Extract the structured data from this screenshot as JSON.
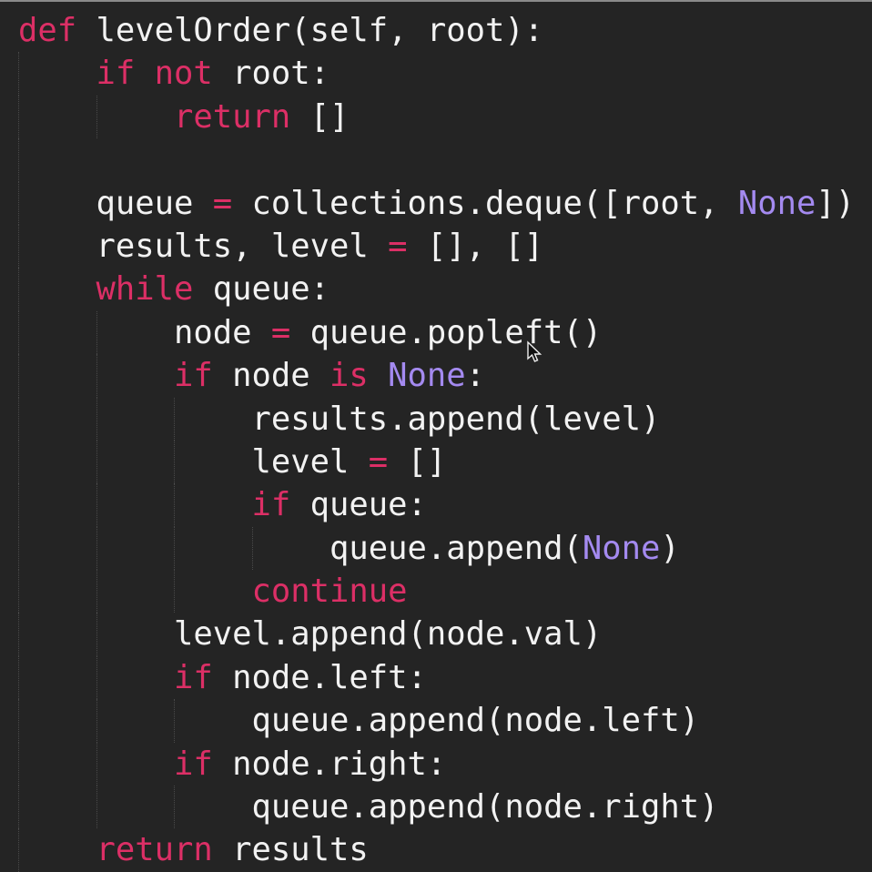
{
  "editor": {
    "colors": {
      "background": "#242424",
      "keyword": "#dc2f66",
      "constant": "#a48af0",
      "text": "#f2f2f2"
    },
    "lines": [
      {
        "indent": 0,
        "tokens": [
          {
            "t": "def",
            "c": "k"
          },
          {
            "t": " levelOrder(self, root):",
            "c": "p"
          }
        ]
      },
      {
        "indent": 1,
        "tokens": [
          {
            "t": "if",
            "c": "k"
          },
          {
            "t": " ",
            "c": "p"
          },
          {
            "t": "not",
            "c": "k"
          },
          {
            "t": " root:",
            "c": "p"
          }
        ]
      },
      {
        "indent": 2,
        "tokens": [
          {
            "t": "return",
            "c": "k"
          },
          {
            "t": " []",
            "c": "p"
          }
        ]
      },
      {
        "indent": 1,
        "tokens": []
      },
      {
        "indent": 1,
        "tokens": [
          {
            "t": "queue ",
            "c": "p"
          },
          {
            "t": "=",
            "c": "o"
          },
          {
            "t": " collections.deque([root, ",
            "c": "p"
          },
          {
            "t": "None",
            "c": "n"
          },
          {
            "t": "])",
            "c": "p"
          }
        ]
      },
      {
        "indent": 1,
        "tokens": [
          {
            "t": "results, level ",
            "c": "p"
          },
          {
            "t": "=",
            "c": "o"
          },
          {
            "t": " [], []",
            "c": "p"
          }
        ]
      },
      {
        "indent": 1,
        "tokens": [
          {
            "t": "while",
            "c": "k"
          },
          {
            "t": " queue:",
            "c": "p"
          }
        ]
      },
      {
        "indent": 2,
        "tokens": [
          {
            "t": "node ",
            "c": "p"
          },
          {
            "t": "=",
            "c": "o"
          },
          {
            "t": " queue.popleft()",
            "c": "p"
          }
        ]
      },
      {
        "indent": 2,
        "tokens": [
          {
            "t": "if",
            "c": "k"
          },
          {
            "t": " node ",
            "c": "p"
          },
          {
            "t": "is",
            "c": "k"
          },
          {
            "t": " ",
            "c": "p"
          },
          {
            "t": "None",
            "c": "n"
          },
          {
            "t": ":",
            "c": "p"
          }
        ]
      },
      {
        "indent": 3,
        "tokens": [
          {
            "t": "results.append(level)",
            "c": "p"
          }
        ]
      },
      {
        "indent": 3,
        "tokens": [
          {
            "t": "level ",
            "c": "p"
          },
          {
            "t": "=",
            "c": "o"
          },
          {
            "t": " []",
            "c": "p"
          }
        ]
      },
      {
        "indent": 3,
        "tokens": [
          {
            "t": "if",
            "c": "k"
          },
          {
            "t": " queue:",
            "c": "p"
          }
        ]
      },
      {
        "indent": 4,
        "tokens": [
          {
            "t": "queue.append(",
            "c": "p"
          },
          {
            "t": "None",
            "c": "n"
          },
          {
            "t": ")",
            "c": "p"
          }
        ]
      },
      {
        "indent": 3,
        "tokens": [
          {
            "t": "continue",
            "c": "k"
          }
        ]
      },
      {
        "indent": 2,
        "tokens": [
          {
            "t": "level.append(node.val)",
            "c": "p"
          }
        ]
      },
      {
        "indent": 2,
        "tokens": [
          {
            "t": "if",
            "c": "k"
          },
          {
            "t": " node.left:",
            "c": "p"
          }
        ]
      },
      {
        "indent": 3,
        "tokens": [
          {
            "t": "queue.append(node.left)",
            "c": "p"
          }
        ]
      },
      {
        "indent": 2,
        "tokens": [
          {
            "t": "if",
            "c": "k"
          },
          {
            "t": " node.right:",
            "c": "p"
          }
        ]
      },
      {
        "indent": 3,
        "tokens": [
          {
            "t": "queue.append(node.right)",
            "c": "p"
          }
        ]
      },
      {
        "indent": 1,
        "tokens": [
          {
            "t": "return",
            "c": "k"
          },
          {
            "t": " results",
            "c": "p"
          }
        ]
      }
    ]
  },
  "cursor": {
    "icon": "mouse-pointer-icon"
  }
}
